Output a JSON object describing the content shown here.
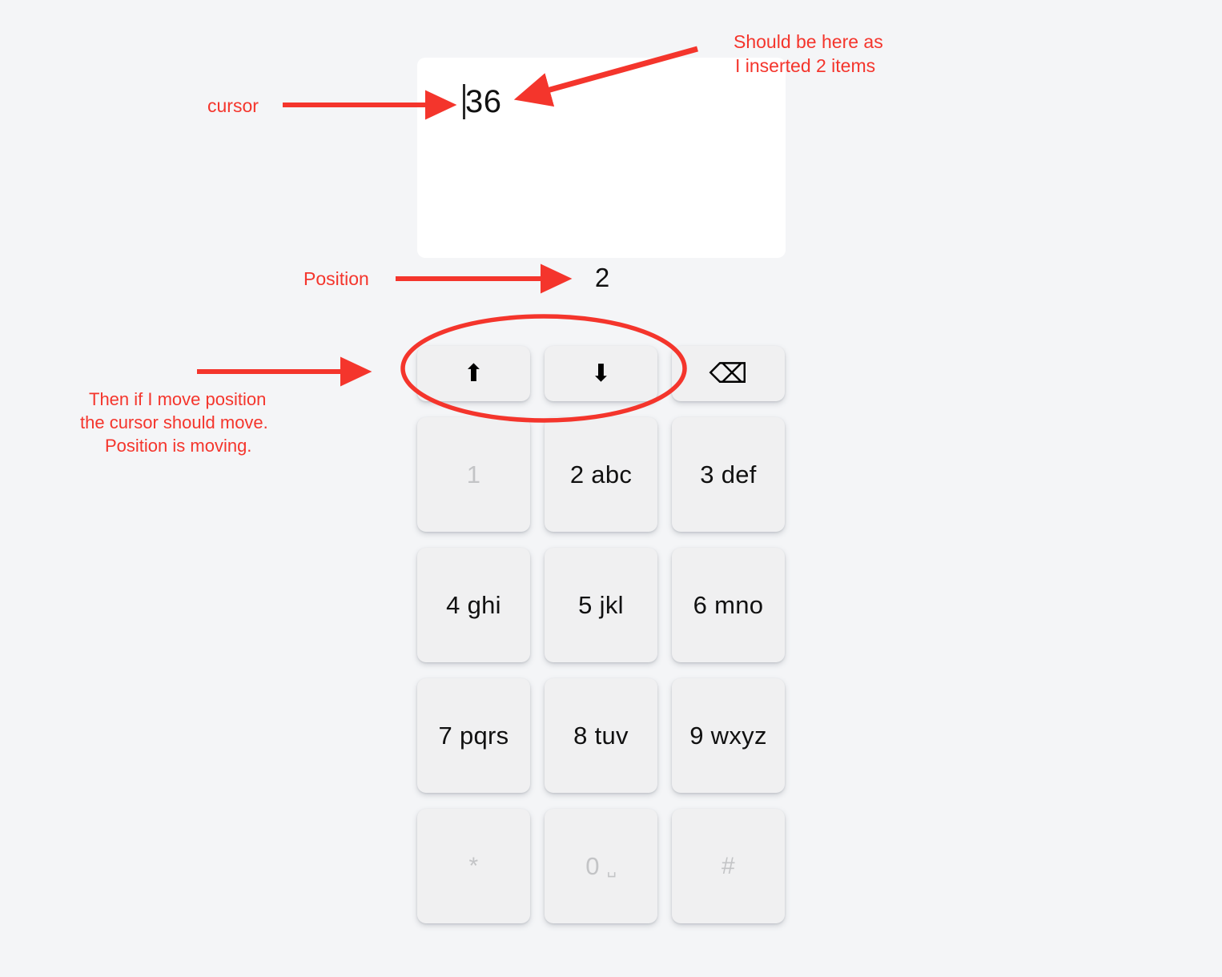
{
  "canvas": {
    "background_color": "#f4f5f7",
    "annotation_color": "#f4352c"
  },
  "text_field": {
    "value": "36",
    "cursor_glyph": "|",
    "card_color": "#ffffff"
  },
  "position": {
    "value": "2"
  },
  "annotations": [
    {
      "id": "cursor",
      "text": "cursor"
    },
    {
      "id": "inserted",
      "line1": "Should be here as",
      "line2": "I inserted 2 items"
    },
    {
      "id": "position",
      "text": "Position"
    },
    {
      "id": "move",
      "line1": "Then if I move position",
      "line2": "the cursor should move.",
      "line3": "Position is moving."
    }
  ],
  "keypad": {
    "function_row": [
      {
        "name": "cursor-up-key",
        "glyph": "⬆",
        "style": "glyph"
      },
      {
        "name": "cursor-down-key",
        "glyph": "⬇",
        "style": "glyph"
      },
      {
        "name": "backspace-key",
        "glyph": "⌫",
        "style": "glyph"
      }
    ],
    "rows": [
      [
        {
          "name": "key-1",
          "label": "1",
          "state": "dim"
        },
        {
          "name": "key-2",
          "label": "2 abc",
          "state": "normal"
        },
        {
          "name": "key-3",
          "label": "3 def",
          "state": "normal"
        }
      ],
      [
        {
          "name": "key-4",
          "label": "4 ghi",
          "state": "normal"
        },
        {
          "name": "key-5",
          "label": "5 jkl",
          "state": "normal"
        },
        {
          "name": "key-6",
          "label": "6 mno",
          "state": "normal"
        }
      ],
      [
        {
          "name": "key-7",
          "label": "7 pqrs",
          "state": "normal"
        },
        {
          "name": "key-8",
          "label": "8 tuv",
          "state": "normal"
        },
        {
          "name": "key-9",
          "label": "9 wxyz",
          "state": "normal"
        }
      ],
      [
        {
          "name": "key-star",
          "label": "*",
          "state": "dim"
        },
        {
          "name": "key-0",
          "label": "0",
          "state": "dim",
          "space_mark": "␣"
        },
        {
          "name": "key-hash",
          "label": "#",
          "state": "dim"
        }
      ]
    ]
  }
}
